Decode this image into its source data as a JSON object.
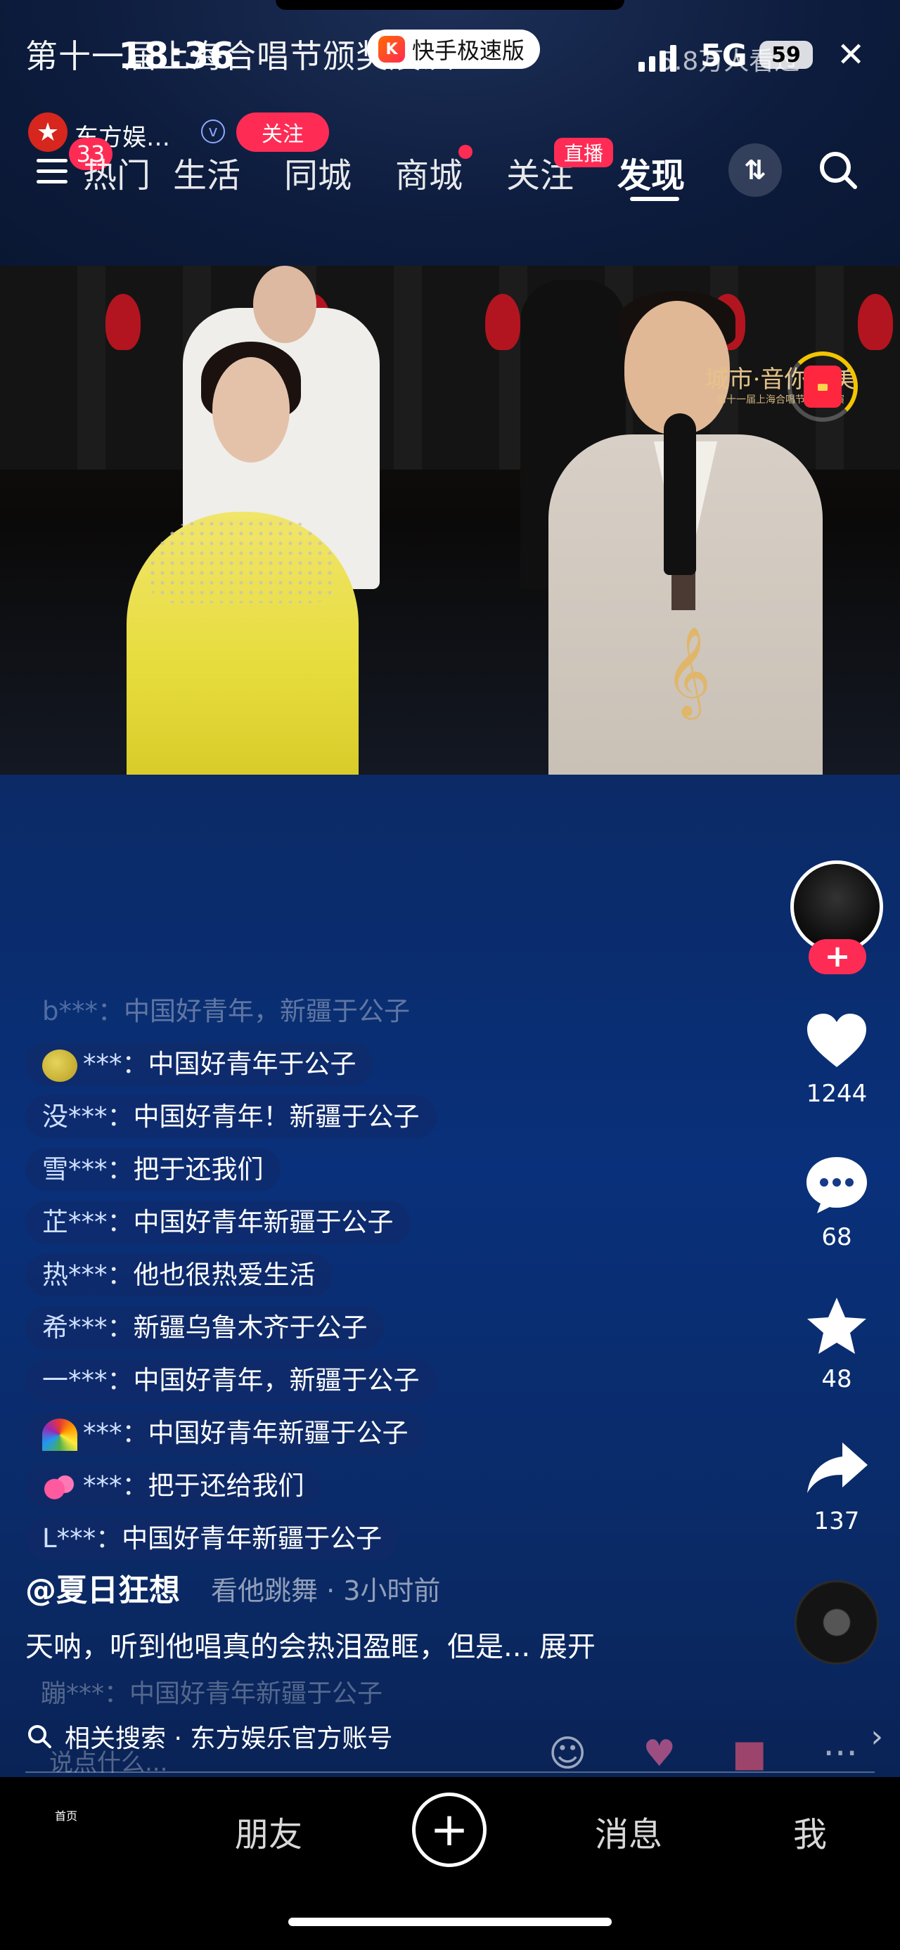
{
  "status_bar": {
    "time": "18:36",
    "network": "5G",
    "battery": "59"
  },
  "live_overlay": {
    "title": "第十一届上海合唱节颁奖展演",
    "app_badge": "快手极速版",
    "viewers": "5.8万人看过"
  },
  "host": {
    "name": "东方娱…",
    "follow_label": "关注"
  },
  "top_nav": {
    "message_count": "33",
    "tabs": [
      {
        "label": "热门"
      },
      {
        "label": "生活"
      },
      {
        "label": "同城"
      },
      {
        "label": "商城"
      },
      {
        "label": "关注"
      },
      {
        "label": "发现"
      }
    ],
    "live_tag": "直播"
  },
  "video": {
    "watermark_title": "城市·音你而美",
    "watermark_sub": "第十一届上海合唱节颁奖展演"
  },
  "actions": {
    "like_count": "1244",
    "comment_count": "68",
    "favorite_count": "48",
    "share_count": "137"
  },
  "comments": [
    {
      "user": "b***",
      "text": "中国好青年，新疆于公子",
      "faded": true
    },
    {
      "user": "***",
      "text": "中国好青年于公子",
      "emoji": "lemon"
    },
    {
      "user": "没***",
      "text": "中国好青年！新疆于公子"
    },
    {
      "user": "雪***",
      "text": "把于还我们"
    },
    {
      "user": "芷***",
      "text": "中国好青年新疆于公子"
    },
    {
      "user": "热***",
      "text": "他也很热爱生活"
    },
    {
      "user": "希***",
      "text": "新疆乌鲁木齐于公子"
    },
    {
      "user": "一***",
      "text": "中国好青年，新疆于公子"
    },
    {
      "user": "***",
      "text": "中国好青年新疆于公子",
      "emoji": "rainbow"
    },
    {
      "user": "***",
      "text": "把于还给我们",
      "emoji": "hearts"
    },
    {
      "user": "L***",
      "text": "中国好青年新疆于公子"
    }
  ],
  "post": {
    "author": "@夏日狂想",
    "author_overlap": "看他跳舞 · 3小时前",
    "description": "天呐，听到他唱真的会热泪盈眶，但是... 展开",
    "bottom_faded_comment": "蹦***：中国好青年新疆于公子",
    "related_search": "相关搜索 · 东方娱乐官方账号",
    "input_placeholder": "说点什么..."
  },
  "tabbar": {
    "home": "首页",
    "friends": "朋友",
    "messages": "消息",
    "me": "我"
  },
  "colors": {
    "accent": "#fe2c55",
    "background": "#0b2a66"
  }
}
